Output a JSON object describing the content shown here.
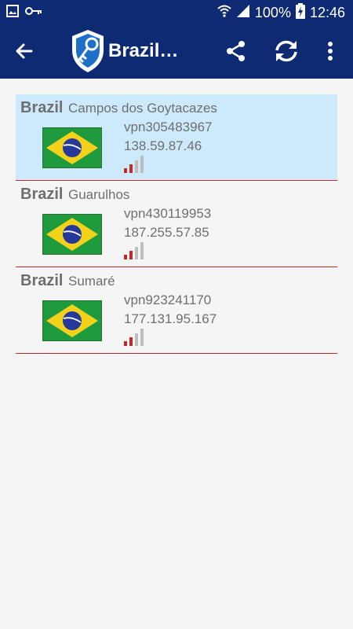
{
  "status_bar": {
    "battery": "100%",
    "time": "12:46"
  },
  "toolbar": {
    "title": "Brazil…"
  },
  "servers": [
    {
      "country": "Brazil",
      "city": "Campos dos Goytacazes",
      "hostname": "vpn305483967",
      "ip": "138.59.87.46",
      "signal_bars": 2,
      "selected": true
    },
    {
      "country": "Brazil",
      "city": "Guarulhos",
      "hostname": "vpn430119953",
      "ip": "187.255.57.85",
      "signal_bars": 2,
      "selected": false
    },
    {
      "country": "Brazil",
      "city": "Sumaré",
      "hostname": "vpn923241170",
      "ip": "177.131.95.167",
      "signal_bars": 2,
      "selected": false
    }
  ],
  "colors": {
    "primary": "#0d2a73",
    "selected_bg": "#cdeafd",
    "divider": "#c62828",
    "signal_active": "#c62828"
  },
  "icons": [
    "image-icon",
    "key-icon",
    "wifi-icon",
    "cell-signal-icon",
    "battery-charging-icon",
    "back-arrow-icon",
    "vpn-shield-key-logo",
    "share-icon",
    "refresh-icon",
    "more-vert-icon",
    "brazil-flag-icon",
    "signal-strength-icon"
  ]
}
